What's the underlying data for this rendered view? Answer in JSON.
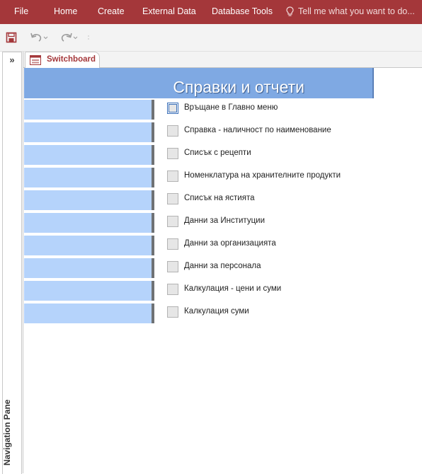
{
  "ribbon": {
    "menu": [
      "File",
      "Home",
      "Create",
      "External Data",
      "Database Tools"
    ],
    "tell_me": "Tell me what you want to do..."
  },
  "nav_pane": {
    "toggle": "»",
    "label": "Navigation Pane"
  },
  "tab": {
    "label": "Switchboard"
  },
  "switchboard": {
    "title": "Справки и отчети",
    "items": [
      "Връщане в Главно меню",
      "Справка  -  наличност по наименование",
      "Списък с рецепти",
      "Номенклатура на хранителните продукти",
      "Списък на ястията",
      "Данни за Институции",
      "Данни за организацията",
      "Данни за персонала",
      "Калкулация - цени и суми",
      "Калкулация суми"
    ]
  },
  "colors": {
    "ribbon": "#a4373a",
    "header_band": "#7fa9e3",
    "left_bar": "#b5d3fb",
    "tab_label": "#a4373a"
  }
}
